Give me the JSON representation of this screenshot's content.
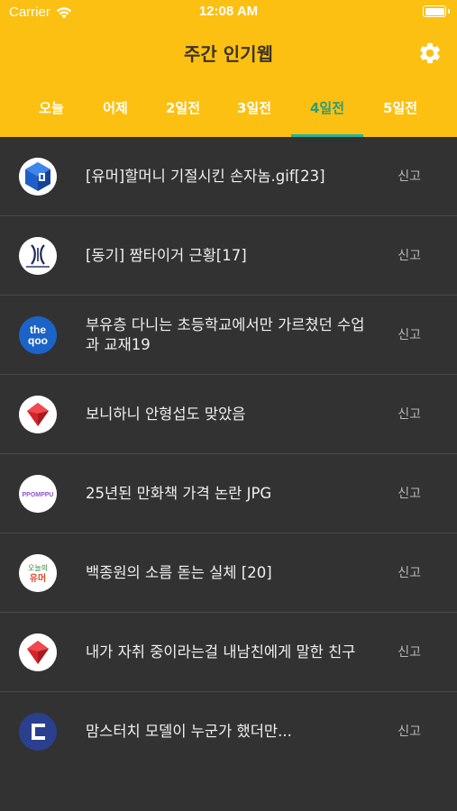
{
  "status_bar": {
    "carrier": "Carrier",
    "time": "12:08 AM"
  },
  "header": {
    "title": "주간 인기웹",
    "settings_icon": "gear-icon"
  },
  "tabs": [
    {
      "label": "오늘",
      "active": false
    },
    {
      "label": "어제",
      "active": false
    },
    {
      "label": "2일전",
      "active": false
    },
    {
      "label": "3일전",
      "active": false
    },
    {
      "label": "4일전",
      "active": true
    },
    {
      "label": "5일전",
      "active": false
    }
  ],
  "posts": [
    {
      "title": "[유머]할머니 기절시킨 손자놈.gif[23]",
      "report_label": "신고",
      "site_icon": "blue-cube-logo-icon"
    },
    {
      "title": "[동기] 짬타이거 근황[17]",
      "report_label": "신고",
      "site_icon": "dogdrip-logo-icon"
    },
    {
      "title": "부유층 다니는 초등학교에서만 가르쳤던 수업과 교재19",
      "report_label": "신고",
      "site_icon": "theqoo-logo-icon",
      "logo_text": "the qoo"
    },
    {
      "title": "보니하니 안형섭도 맞았음",
      "report_label": "신고",
      "site_icon": "red-gem-logo-icon"
    },
    {
      "title": " 25년된 만화책 가격 논란 JPG",
      "report_label": "신고",
      "site_icon": "ppomppu-logo-icon",
      "logo_text": "PPOMPPU"
    },
    {
      "title": "백종원의 소름 돋는 실체 [20]",
      "report_label": "신고",
      "site_icon": "todayhumor-logo-icon",
      "logo_text": "오늘의 유머"
    },
    {
      "title": "내가 자취 중이라는걸 내남친에게 말한 친구",
      "report_label": "신고",
      "site_icon": "red-gem-logo-icon"
    },
    {
      "title": "맘스터치 모델이 누군가 했더만...",
      "report_label": "신고",
      "site_icon": "clien-logo-icon"
    }
  ],
  "colors": {
    "header_bg": "#fcc012",
    "list_bg": "#323232",
    "active_tab": "#2a9d7a",
    "divider": "#4a4a4a"
  }
}
